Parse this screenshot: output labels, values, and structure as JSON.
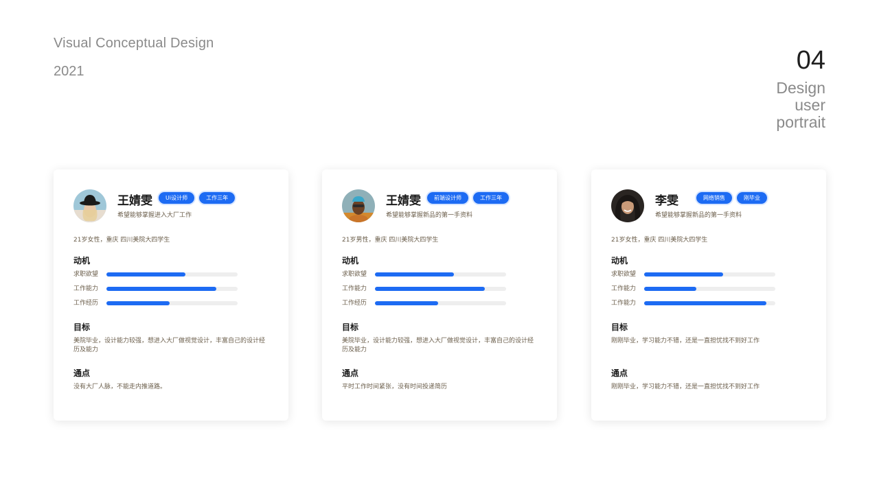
{
  "header": {
    "title": "Visual Conceptual Design",
    "year": "2021",
    "page_number": "04",
    "section_title": [
      "Design",
      "user",
      "portrait"
    ]
  },
  "labels": {
    "motivation": "动机",
    "goal": "目标",
    "pain_point": "通点"
  },
  "colors": {
    "accent": "#1d6bf3",
    "track": "#eeeeee",
    "muted_text": "#6a5d4a"
  },
  "cards": [
    {
      "name": "王婧雯",
      "tags": [
        "Ui设计师",
        "工作三年"
      ],
      "wish": "希望能够掌握进入大厂工作",
      "profile": "21岁女性，重庆  四川美院大四学生",
      "bars": [
        {
          "label": "求职欲望",
          "value": 0.6
        },
        {
          "label": "工作能力",
          "value": 0.84
        },
        {
          "label": "工作经历",
          "value": 0.48
        }
      ],
      "goal": "美院毕业，设计能力较强，想进入大厂做视觉设计，丰富自己的设计经历及能力",
      "pain": "没有大厂人脉，不能走内推道路。"
    },
    {
      "name": "王婧雯",
      "tags": [
        "前端设计师",
        "工作三年"
      ],
      "wish": "希望能够掌握新品的第一手资料",
      "profile": "21岁男性，重庆  四川美院大四学生",
      "bars": [
        {
          "label": "求职欲望",
          "value": 0.6
        },
        {
          "label": "工作能力",
          "value": 0.84
        },
        {
          "label": "工作经历",
          "value": 0.48
        }
      ],
      "goal": "美院毕业，设计能力较强，想进入大厂做视觉设计，丰富自己的设计经历及能力",
      "pain": "平时工作时间紧张，没有时间投递简历"
    },
    {
      "name": "李雯",
      "tags": [
        "网络销售",
        "刚毕业"
      ],
      "wish": "希望能够掌握新品的第一手资料",
      "profile": "21岁女性，重庆  四川美院大四学生",
      "bars": [
        {
          "label": "求职欲望",
          "value": 0.6
        },
        {
          "label": "工作能力",
          "value": 0.4
        },
        {
          "label": "工作能力",
          "value": 0.93
        }
      ],
      "goal": "刚刚毕业，学习能力不错，还是一直担忧找不到好工作",
      "pain": "刚刚毕业，学习能力不错，还是一直担忧找不到好工作"
    }
  ]
}
